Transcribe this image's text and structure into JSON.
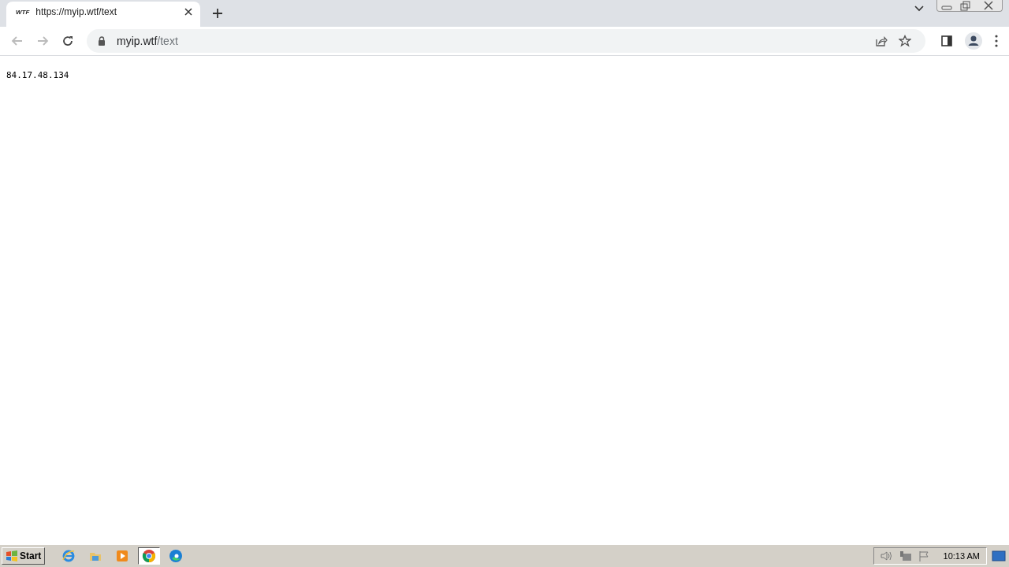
{
  "tabs": [
    {
      "favicon": "WTF",
      "title": "https://myip.wtf/text",
      "selected": true
    }
  ],
  "address_bar": {
    "host": "myip.wtf",
    "path": "/text"
  },
  "page": {
    "text": "84.17.48.134"
  },
  "taskbar": {
    "start": "Start",
    "apps": [
      {
        "kind": "ie",
        "selected": false
      },
      {
        "kind": "folder",
        "selected": false
      },
      {
        "kind": "media",
        "selected": false
      },
      {
        "kind": "chrome",
        "selected": true
      },
      {
        "kind": "edge",
        "selected": false
      }
    ],
    "clock": "10:13 AM"
  }
}
